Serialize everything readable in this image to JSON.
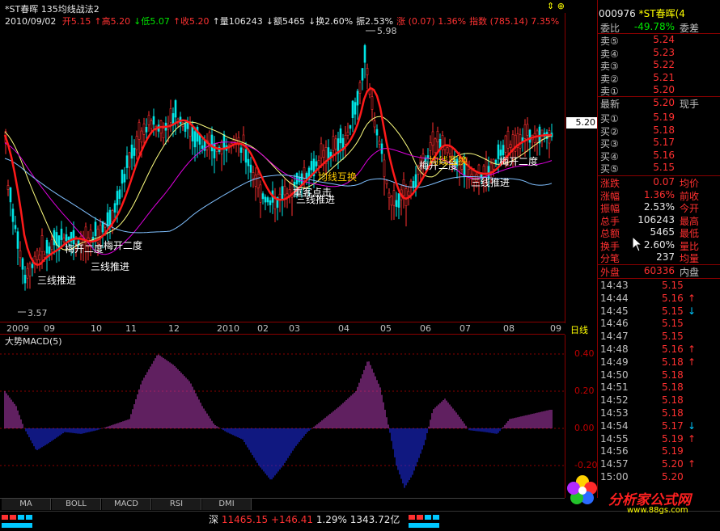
{
  "header": {
    "stock_title": "*ST春晖  135均线战法2",
    "date": "2010/09/02",
    "ohlc": [
      {
        "label": "开5.15",
        "cls": "red"
      },
      {
        "label": "↑高5.20",
        "cls": "red"
      },
      {
        "label": "↓低5.07",
        "cls": "green"
      },
      {
        "label": "↑收5.20",
        "cls": "red"
      },
      {
        "label": "↑量106243",
        "cls": "white"
      },
      {
        "label": "↓额5465",
        "cls": "white"
      },
      {
        "label": "↓换2.60%",
        "cls": "white"
      },
      {
        "label": "振2.53%",
        "cls": "white"
      },
      {
        "label": "涨 (0.07) 1.36%",
        "cls": "red"
      },
      {
        "label": "指数 (785.14) 7.35%",
        "cls": "red"
      }
    ],
    "icons": "⇕ ⊕"
  },
  "price_chart": {
    "high_label": "5.98",
    "low_label": "3.57",
    "current_price_tag": "5.20",
    "annotations": [
      {
        "text": "三线推进",
        "cls": "white"
      },
      {
        "text": "梅开二度",
        "cls": "white"
      },
      {
        "text": "梅开二度",
        "cls": "white"
      },
      {
        "text": "三线推进",
        "cls": "white"
      },
      {
        "text": "均线互换",
        "cls": "yellow"
      },
      {
        "text": "重客点击",
        "cls": "white"
      },
      {
        "text": "三线推进",
        "cls": "white"
      },
      {
        "text": "梅开二度",
        "cls": "white"
      },
      {
        "text": "均线互换",
        "cls": "yellow"
      },
      {
        "text": "梅开二度",
        "cls": "white"
      },
      {
        "text": "三线推进",
        "cls": "white"
      }
    ]
  },
  "time_axis": {
    "labels": [
      "2009",
      "09",
      "10",
      "11",
      "12",
      "2010",
      "02",
      "03",
      "04",
      "05",
      "06",
      "07",
      "08",
      "09"
    ],
    "period": "日线"
  },
  "macd": {
    "title": "大势MACD(5)",
    "ticks": [
      "0.40",
      "0.20",
      "0.00",
      "-0.20"
    ]
  },
  "tabs": [
    "MA",
    "BOLL",
    "MACD",
    "RSI",
    "DMI"
  ],
  "status_bar": {
    "market": "深",
    "index": "11465.15",
    "change": "+146.41",
    "pct": "1.29%",
    "amount": "1343.72亿"
  },
  "panel": {
    "code": "000976",
    "name": "*ST春晖",
    "suffix": "(4",
    "weibi": {
      "label": "委比",
      "value": "-49.78%",
      "label2": "委差"
    },
    "sells": [
      {
        "label": "卖⑤",
        "price": "5.24"
      },
      {
        "label": "卖④",
        "price": "5.23"
      },
      {
        "label": "卖③",
        "price": "5.22"
      },
      {
        "label": "卖②",
        "price": "5.21"
      },
      {
        "label": "卖①",
        "price": "5.20"
      }
    ],
    "latest": {
      "label": "最新",
      "value": "5.20",
      "label2": "现手"
    },
    "buys": [
      {
        "label": "买①",
        "price": "5.19"
      },
      {
        "label": "买②",
        "price": "5.18"
      },
      {
        "label": "买③",
        "price": "5.17"
      },
      {
        "label": "买④",
        "price": "5.16"
      },
      {
        "label": "买⑤",
        "price": "5.15"
      }
    ],
    "stats": [
      {
        "label": "涨跌",
        "value": "0.07",
        "label2": "均价",
        "vcls": "red"
      },
      {
        "label": "涨幅",
        "value": "1.36%",
        "label2": "前收",
        "vcls": "red"
      },
      {
        "label": "振幅",
        "value": "2.53%",
        "label2": "今开",
        "vcls": "white"
      },
      {
        "label": "总手",
        "value": "106243",
        "label2": "最高",
        "vcls": "white"
      },
      {
        "label": "总额",
        "value": "5465",
        "label2": "最低",
        "vcls": "white"
      },
      {
        "label": "换手",
        "value": "2.60%",
        "label2": "量比",
        "vcls": "white"
      },
      {
        "label": "分笔",
        "value": "237",
        "label2": "均量",
        "vcls": "white"
      }
    ],
    "outer": {
      "label": "外盘",
      "value": "60336",
      "label2": "内盘"
    },
    "ticks": [
      {
        "time": "14:43",
        "price": "5.15",
        "arrow": ""
      },
      {
        "time": "14:44",
        "price": "5.16",
        "arrow": "↑"
      },
      {
        "time": "14:45",
        "price": "5.15",
        "arrow": "↓"
      },
      {
        "time": "14:46",
        "price": "5.15",
        "arrow": ""
      },
      {
        "time": "14:47",
        "price": "5.15",
        "arrow": ""
      },
      {
        "time": "14:48",
        "price": "5.16",
        "arrow": "↑"
      },
      {
        "time": "14:49",
        "price": "5.18",
        "arrow": "↑"
      },
      {
        "time": "14:50",
        "price": "5.18",
        "arrow": ""
      },
      {
        "time": "14:51",
        "price": "5.18",
        "arrow": ""
      },
      {
        "time": "14:52",
        "price": "5.18",
        "arrow": ""
      },
      {
        "time": "14:53",
        "price": "5.18",
        "arrow": ""
      },
      {
        "time": "14:54",
        "price": "5.17",
        "arrow": "↓"
      },
      {
        "time": "14:55",
        "price": "5.19",
        "arrow": "↑"
      },
      {
        "time": "14:56",
        "price": "5.19",
        "arrow": ""
      },
      {
        "time": "14:57",
        "price": "5.20",
        "arrow": "↑"
      },
      {
        "time": "15:00",
        "price": "5.20",
        "arrow": ""
      }
    ]
  },
  "logo": {
    "name": "分析家公式网",
    "url": "www.88gs.com"
  }
}
